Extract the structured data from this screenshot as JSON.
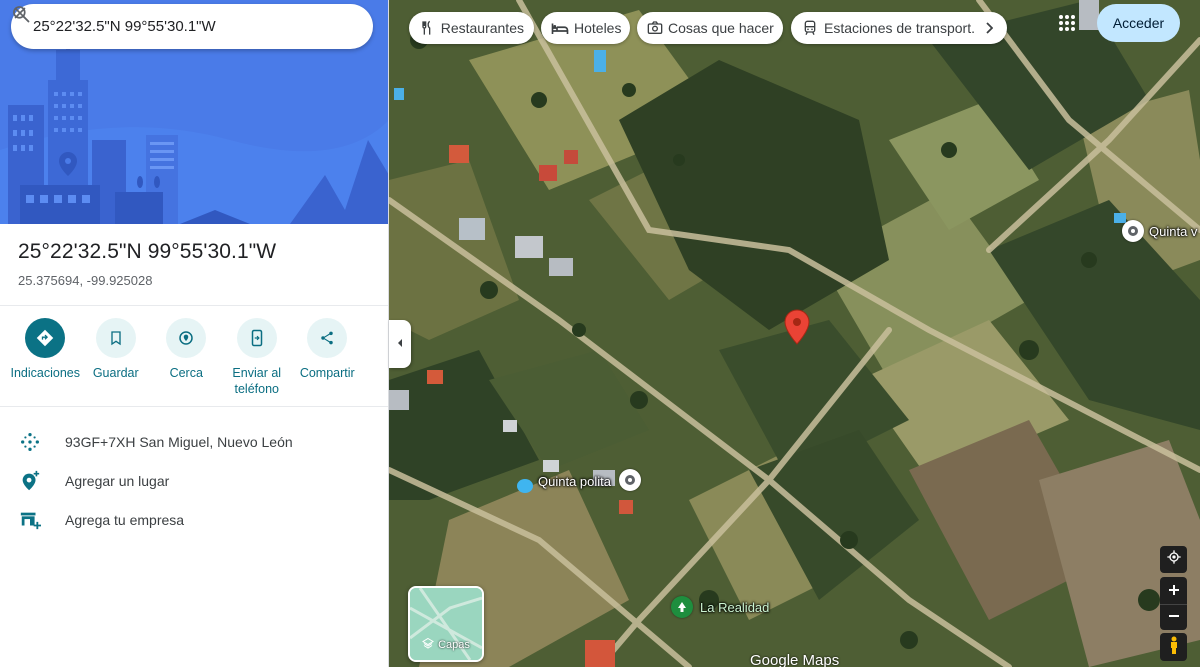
{
  "search": {
    "value": "25°22'32.5\"N 99°55'30.1\"W"
  },
  "place": {
    "title": "25°22'32.5\"N 99°55'30.1\"W",
    "coords": "25.375694, -99.925028"
  },
  "actions": [
    {
      "label": "Indicaciones",
      "icon": "directions-icon"
    },
    {
      "label": "Guardar",
      "icon": "bookmark-icon"
    },
    {
      "label": "Cerca",
      "icon": "nearby-icon"
    },
    {
      "label": "Enviar al teléfono",
      "icon": "send-to-phone-icon"
    },
    {
      "label": "Compartir",
      "icon": "share-icon"
    }
  ],
  "info": [
    {
      "text": "93GF+7XH San Miguel, Nuevo León",
      "icon": "plus-code-icon"
    },
    {
      "text": "Agregar un lugar",
      "icon": "add-place-icon"
    },
    {
      "text": "Agrega tu empresa",
      "icon": "add-business-icon"
    }
  ],
  "chips": [
    {
      "label": "Restaurantes",
      "icon": "restaurant-icon"
    },
    {
      "label": "Hoteles",
      "icon": "hotel-icon"
    },
    {
      "label": "Cosas que hacer",
      "icon": "camera-icon"
    },
    {
      "label": "Estaciones de transport.",
      "icon": "transit-icon"
    }
  ],
  "header": {
    "signin_label": "Acceder"
  },
  "map": {
    "labels": {
      "quinta_polita": "Quinta polita",
      "la_realidad": "La Realidad",
      "quinta_v": "Quinta v"
    },
    "layers_label": "Capas",
    "watermark": "Google Maps"
  },
  "colors": {
    "accent": "#0b7285",
    "accent_light": "#e6f4f5",
    "signin_bg": "#c2e7ff",
    "pin": "#ea4335",
    "hero_bg": "#4a78e8"
  }
}
